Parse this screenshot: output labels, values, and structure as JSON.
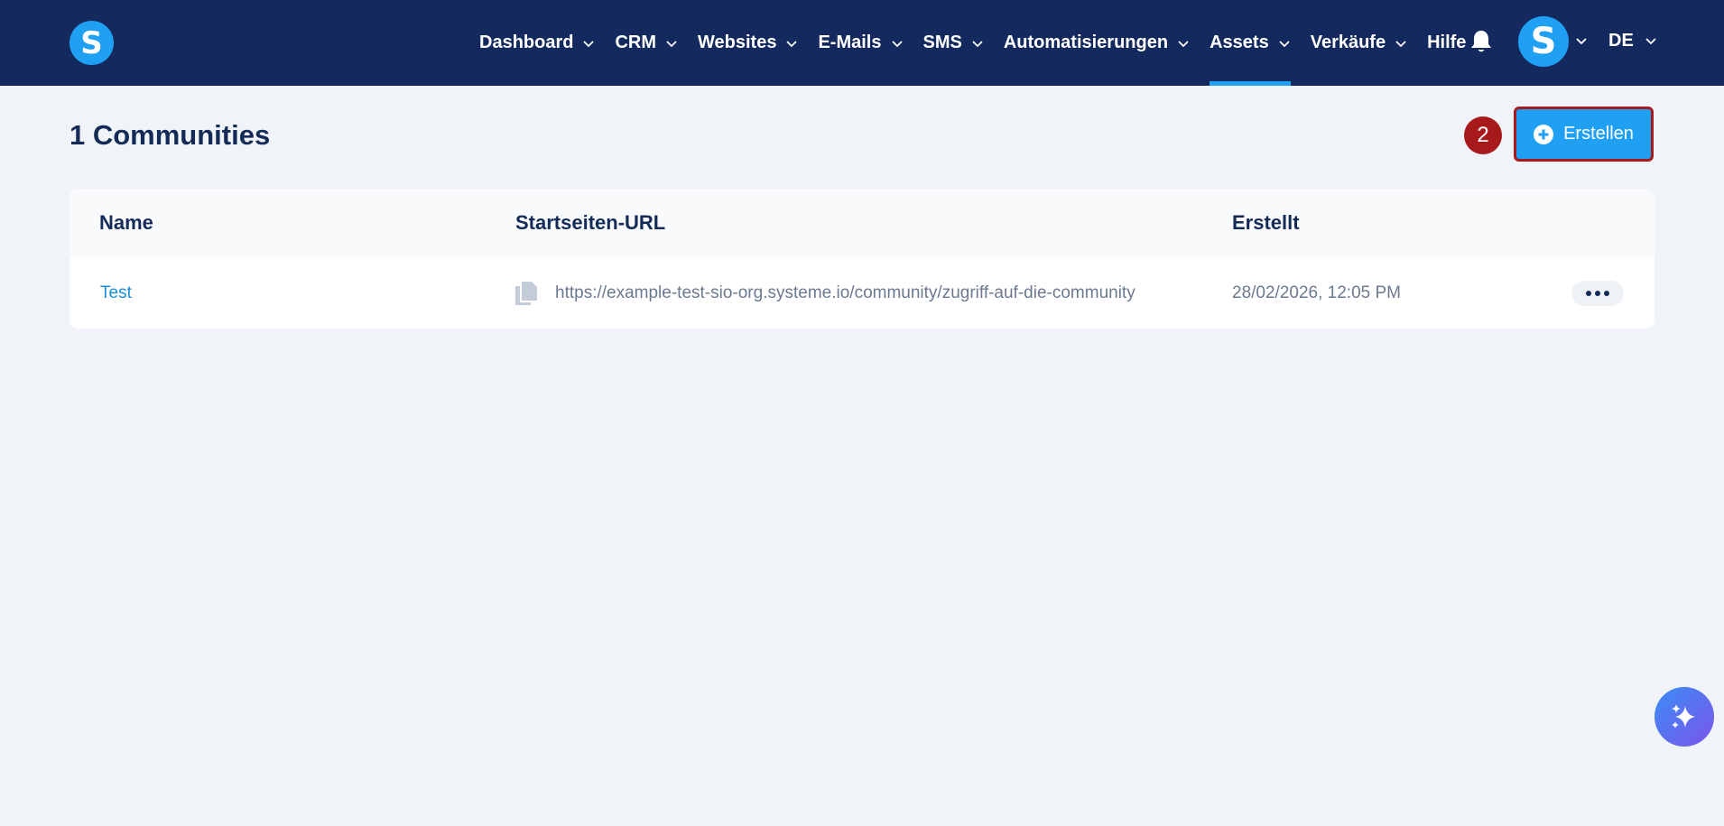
{
  "brand": {
    "logo_letter": "S"
  },
  "nav": {
    "items": [
      {
        "label": "Dashboard",
        "has_dropdown": true
      },
      {
        "label": "CRM",
        "has_dropdown": true
      },
      {
        "label": "Websites",
        "has_dropdown": true
      },
      {
        "label": "E-Mails",
        "has_dropdown": true
      },
      {
        "label": "SMS",
        "has_dropdown": true
      },
      {
        "label": "Automatisierungen",
        "has_dropdown": true
      },
      {
        "label": "Assets",
        "has_dropdown": true,
        "active": true
      },
      {
        "label": "Verkäufe",
        "has_dropdown": true
      },
      {
        "label": "Hilfe",
        "has_dropdown": false
      }
    ],
    "notification_icon": "bell-icon",
    "avatar_letter": "S",
    "language": "DE"
  },
  "page": {
    "title": "1 Communities",
    "step_badge": "2",
    "create_label": "Erstellen"
  },
  "table": {
    "columns": [
      "Name",
      "Startseiten-URL",
      "Erstellt"
    ],
    "rows": [
      {
        "name": "Test",
        "url": "https://example-test-sio-org.systeme.io/community/zugriff-auf-die-community",
        "created": "28/02/2026, 12:05 PM"
      }
    ]
  },
  "colors": {
    "nav_bg": "#142a5e",
    "accent": "#1fa0f2",
    "highlight": "#a8191c",
    "page_bg": "#f0f4f9"
  }
}
